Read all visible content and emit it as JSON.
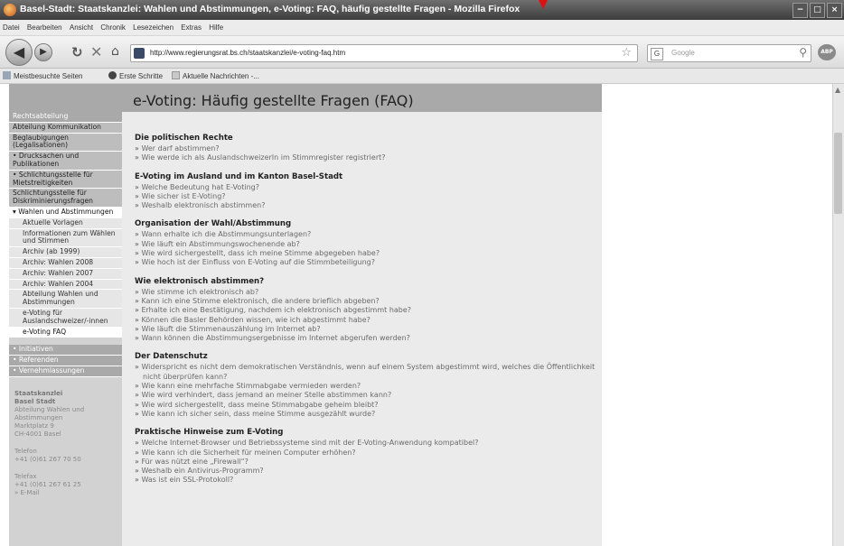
{
  "window": {
    "title": "Basel-Stadt: Staatskanzlei: Wahlen und Abstimmungen, e-Voting: FAQ, häufig gestellte Fragen - Mozilla Firefox",
    "buttons": [
      "−",
      "□",
      "×"
    ]
  },
  "menu": [
    "Datei",
    "Bearbeiten",
    "Ansicht",
    "Chronik",
    "Lesezeichen",
    "Extras",
    "Hilfe"
  ],
  "navbar": {
    "url": "http://www.regierungsrat.bs.ch/staatskanzlei/e-voting-faq.htm",
    "search_placeholder": "Google"
  },
  "bookmarks": [
    "Meistbesuchte Seiten",
    "Erste Schritte",
    "Aktuelle Nachrichten -..."
  ],
  "sidebar": {
    "items": [
      {
        "label": "Rechtsabteilung",
        "style": "dark"
      },
      {
        "label": "Abteilung Kommunikation",
        "style": "mid"
      },
      {
        "label": "Beglaubigungen (Legalisationen)",
        "style": "mid"
      },
      {
        "label": "• Drucksachen und Publikationen",
        "style": "mid"
      },
      {
        "label": "• Schlichtungsstelle für Mietstreitigkeiten",
        "style": "mid"
      },
      {
        "label": "Schlichtungsstelle für Diskriminierungsfragen",
        "style": "mid"
      },
      {
        "label": "▾ Wahlen und Abstimmungen",
        "style": "active"
      },
      {
        "label": "Aktuelle Vorlagen",
        "style": "sub"
      },
      {
        "label": "Informationen zum Wählen und Stimmen",
        "style": "sub"
      },
      {
        "label": "Archiv (ab 1999)",
        "style": "sub"
      },
      {
        "label": "Archiv: Wahlen 2008",
        "style": "sub"
      },
      {
        "label": "Archiv: Wahlen 2007",
        "style": "sub"
      },
      {
        "label": "Archiv: Wahlen 2004",
        "style": "sub"
      },
      {
        "label": "Abteilung Wahlen und Abstimmungen",
        "style": "sub"
      },
      {
        "label": "e-Voting für Auslandschweizer/-innen",
        "style": "sub"
      },
      {
        "label": "e-Voting FAQ",
        "style": "sub active"
      },
      {
        "label": "• Initiativen",
        "style": "dark"
      },
      {
        "label": "• Referenden",
        "style": "dark"
      },
      {
        "label": "• Vernehmlassungen",
        "style": "dark"
      }
    ],
    "address": {
      "org1": "Staatskanzlei",
      "org2": "Basel Stadt",
      "dept1": "Abteilung Wahlen und",
      "dept2": "Abstimmungen",
      "street": "Marktplatz 9",
      "city": "CH-4001 Basel",
      "tel_label": "Telefon",
      "tel": "+41 (0)61 267 70 50",
      "fax_label": "Telefax",
      "fax": "+41 (0)61 267 61 25",
      "email": "» E-Mail"
    }
  },
  "page": {
    "title": "e-Voting: Häufig gestellte Fragen (FAQ)",
    "sections": [
      {
        "heading": "Die politischen Rechte",
        "items": [
          "Wer darf abstimmen?",
          "Wie werde ich als AuslandschweizerIn im Stimmregister registriert?"
        ]
      },
      {
        "heading": "E-Voting im Ausland und im Kanton Basel-Stadt",
        "items": [
          "Welche Bedeutung hat E-Voting?",
          "Wie sicher ist E-Voting?",
          "Weshalb elektronisch abstimmen?"
        ]
      },
      {
        "heading": "Organisation der Wahl/Abstimmung",
        "items": [
          "Wann erhalte ich die Abstimmungsunterlagen?",
          "Wie läuft ein Abstimmungswochenende ab?",
          "Wie wird sichergestellt, dass ich meine Stimme abgegeben habe?",
          "Wie hoch ist der Einfluss von E-Voting auf die Stimmbeteiligung?"
        ]
      },
      {
        "heading": "Wie elektronisch abstimmen?",
        "items": [
          "Wie stimme ich elektronisch ab?",
          "Kann ich eine Stimme elektronisch, die andere brieflich abgeben?",
          "Erhalte ich eine Bestätigung, nachdem ich elektronisch abgestimmt habe?",
          "Können die Basler Behörden wissen, wie ich abgestimmt habe?",
          "Wie läuft die Stimmenauszählung im Internet ab?",
          "Wann können die Abstimmungsergebnisse im Internet abgerufen werden?"
        ]
      },
      {
        "heading": "Der Datenschutz",
        "items": [
          "Widerspricht es nicht dem demokratischen Verständnis, wenn auf einem System abgestimmt wird, welches die Öffentlichkeit nicht überprüfen kann?",
          "Wie kann eine mehrfache Stimmabgabe vermieden werden?",
          "Wie wird verhindert, dass jemand an meiner Stelle abstimmen kann?",
          "Wie wird sichergestellt, dass meine Stimmabgabe geheim bleibt?",
          "Wie kann ich sicher sein, dass meine Stimme ausgezählt wurde?"
        ]
      },
      {
        "heading": "Praktische Hinweise zum E-Voting",
        "items": [
          "Welche Internet-Browser und Betriebssysteme sind mit der E-Voting-Anwendung kompatibel?",
          "Wie kann ich die Sicherheit für meinen Computer erhöhen?",
          "Für was nützt eine „Firewall“?",
          "Weshalb ein Antivirus-Programm?",
          "Was ist ein SSL-Protokoll?"
        ]
      }
    ]
  }
}
